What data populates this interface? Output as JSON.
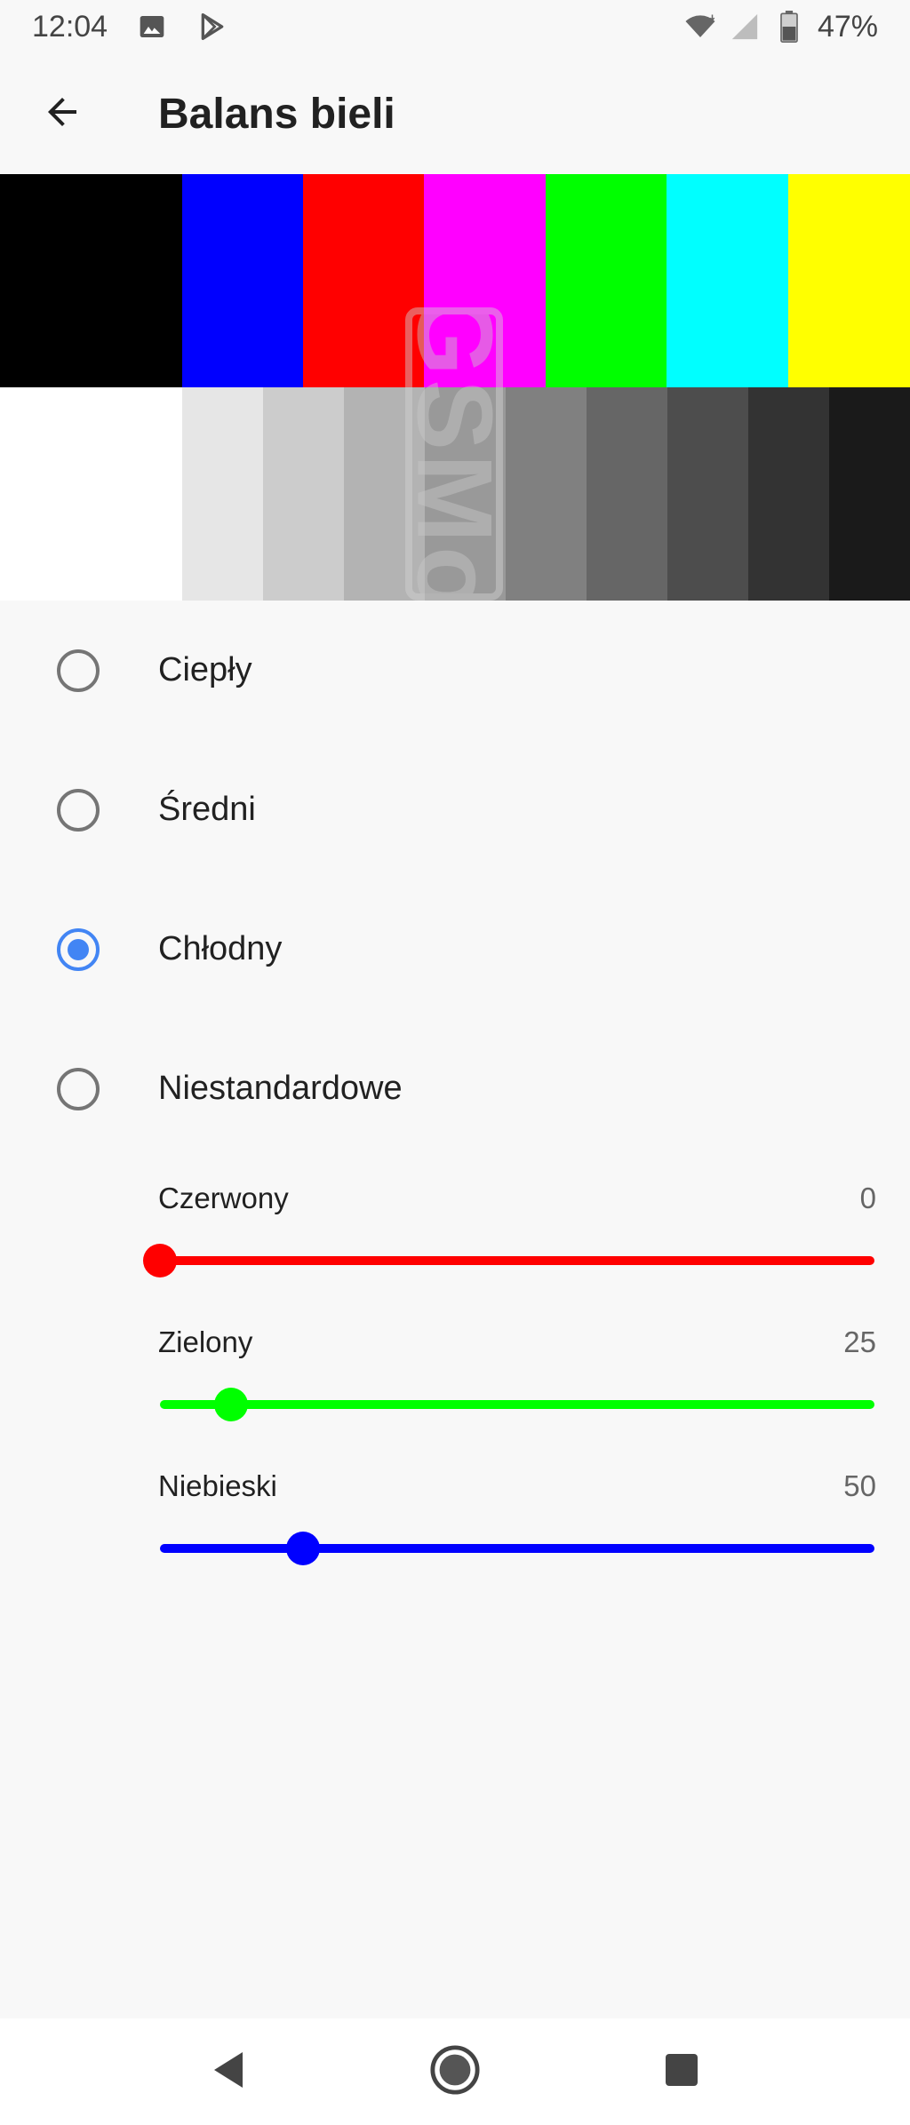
{
  "status_bar": {
    "time": "12:04",
    "battery_percent": "47%",
    "icons": [
      "image-icon",
      "play-store-icon",
      "wifi-icon",
      "signal-icon",
      "battery-icon"
    ]
  },
  "app_bar": {
    "title": "Balans bieli",
    "back_icon": "arrow-back-icon"
  },
  "pattern": {
    "top_colors": [
      "#000000",
      "#0000ff",
      "#ff0000",
      "#ff00ff",
      "#00ff00",
      "#00ffff",
      "#ffff00"
    ],
    "bottom_colors": [
      "#ffffff",
      "#e6e6e6",
      "#cccccc",
      "#b3b3b3",
      "#999999",
      "#808080",
      "#666666",
      "#4d4d4d",
      "#333333",
      "#1a1a1a"
    ],
    "watermark": "GSMo"
  },
  "options": [
    {
      "label": "Ciepły",
      "selected": false
    },
    {
      "label": "Średni",
      "selected": false
    },
    {
      "label": "Chłodny",
      "selected": true
    },
    {
      "label": "Niestandardowe",
      "selected": false
    }
  ],
  "sliders": [
    {
      "label": "Czerwony",
      "value": "0",
      "fraction": 0.0,
      "color": "#ff0000"
    },
    {
      "label": "Zielony",
      "value": "25",
      "fraction": 0.1,
      "color": "#00ff00"
    },
    {
      "label": "Niebieski",
      "value": "50",
      "fraction": 0.2,
      "color": "#0000ff"
    }
  ],
  "accent_color": "#4285f4",
  "nav_bar": {
    "icons": [
      "nav-back-icon",
      "nav-home-icon",
      "nav-recents-icon"
    ]
  }
}
